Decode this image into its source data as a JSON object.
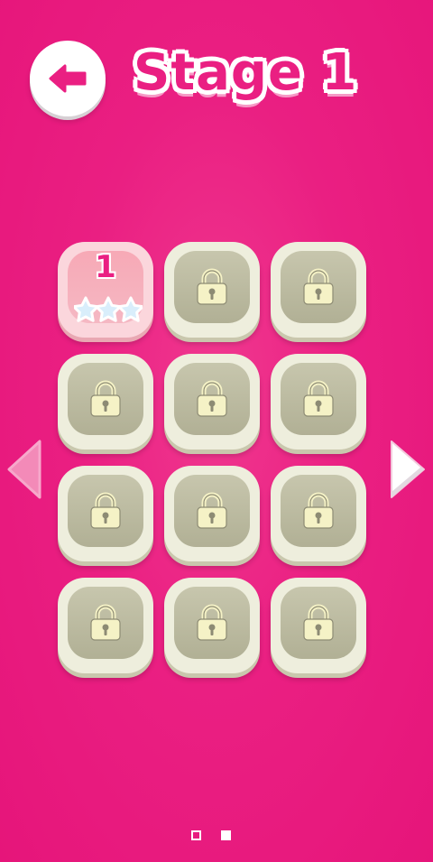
{
  "header": {
    "title": "Stage 1",
    "back_icon": "arrow-left-icon"
  },
  "levels": [
    {
      "number": "1",
      "locked": false,
      "stars": 3
    },
    {
      "locked": true
    },
    {
      "locked": true
    },
    {
      "locked": true
    },
    {
      "locked": true
    },
    {
      "locked": true
    },
    {
      "locked": true
    },
    {
      "locked": true
    },
    {
      "locked": true
    },
    {
      "locked": true
    },
    {
      "locked": true
    },
    {
      "locked": true
    }
  ],
  "pagination": {
    "current_page": 2,
    "total_pages": 2
  },
  "colors": {
    "background": "#e6157a",
    "accent": "#ea1f82",
    "locked_tile": "#eeeedd",
    "lock_icon": "#f5f2c6",
    "star": "#d9eefb"
  }
}
